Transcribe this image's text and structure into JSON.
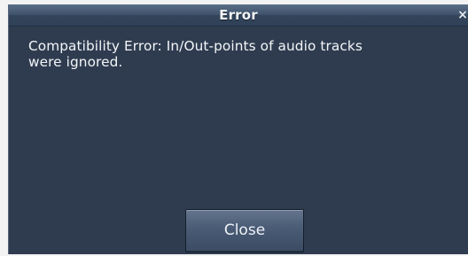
{
  "dialog": {
    "title": "Error",
    "close_glyph": "×",
    "message_line_1": "Compatibility Error: In/Out-points of audio tracks",
    "message_line_2": "were ignored.",
    "close_button_label": "Close"
  },
  "colors": {
    "dialog_background": "#2f3c50",
    "titlebar": "#3f526a",
    "text": "#f3f6f8",
    "button": "#4b5d77"
  },
  "icons": {
    "close": "close-icon"
  }
}
